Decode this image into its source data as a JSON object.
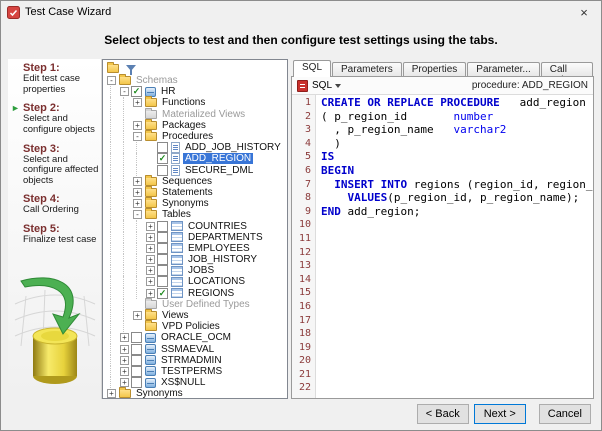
{
  "window": {
    "title": "Test Case Wizard",
    "close_glyph": "×"
  },
  "header": {
    "instruction": "Select objects to test and then configure test settings using the tabs."
  },
  "steps": [
    {
      "title": "Step 1:",
      "desc": "Edit test case properties",
      "current": false
    },
    {
      "title": "Step 2:",
      "desc": "Select and configure objects",
      "current": true
    },
    {
      "title": "Step 3:",
      "desc": "Select and configure affected objects",
      "current": false
    },
    {
      "title": "Step 4:",
      "desc": "Call Ordering",
      "current": false
    },
    {
      "title": "Step 5:",
      "desc": "Finalize test case",
      "current": false
    }
  ],
  "tree": {
    "rows": [
      {
        "label": "Schemas",
        "indent": 0,
        "exp": "minus",
        "icon": "folder",
        "gray": true
      },
      {
        "label": "HR",
        "indent": 1,
        "exp": "minus",
        "check": "on",
        "icon": "db"
      },
      {
        "label": "Functions",
        "indent": 2,
        "exp": "plus",
        "icon": "folder"
      },
      {
        "label": "Materialized Views",
        "indent": 2,
        "icon": "folder-gray",
        "gray": true
      },
      {
        "label": "Packages",
        "indent": 2,
        "exp": "plus",
        "icon": "folder"
      },
      {
        "label": "Procedures",
        "indent": 2,
        "exp": "minus",
        "icon": "folder"
      },
      {
        "label": "ADD_JOB_HISTORY",
        "indent": 3,
        "check": "off",
        "icon": "proc"
      },
      {
        "label": "ADD_REGION",
        "indent": 3,
        "check": "on",
        "icon": "proc",
        "selected": true
      },
      {
        "label": "SECURE_DML",
        "indent": 3,
        "check": "off",
        "icon": "proc"
      },
      {
        "label": "Sequences",
        "indent": 2,
        "exp": "plus",
        "icon": "folder"
      },
      {
        "label": "Statements",
        "indent": 2,
        "exp": "plus",
        "icon": "folder"
      },
      {
        "label": "Synonyms",
        "indent": 2,
        "exp": "plus",
        "icon": "folder"
      },
      {
        "label": "Tables",
        "indent": 2,
        "exp": "minus",
        "icon": "folder"
      },
      {
        "label": "COUNTRIES",
        "indent": 3,
        "exp": "plus",
        "check": "off",
        "icon": "table"
      },
      {
        "label": "DEPARTMENTS",
        "indent": 3,
        "exp": "plus",
        "check": "off",
        "icon": "table"
      },
      {
        "label": "EMPLOYEES",
        "indent": 3,
        "exp": "plus",
        "check": "off",
        "icon": "table"
      },
      {
        "label": "JOB_HISTORY",
        "indent": 3,
        "exp": "plus",
        "check": "off",
        "icon": "table"
      },
      {
        "label": "JOBS",
        "indent": 3,
        "exp": "plus",
        "check": "off",
        "icon": "table"
      },
      {
        "label": "LOCATIONS",
        "indent": 3,
        "exp": "plus",
        "check": "off",
        "icon": "table"
      },
      {
        "label": "REGIONS",
        "indent": 3,
        "exp": "plus",
        "check": "on",
        "icon": "table"
      },
      {
        "label": "User Defined Types",
        "indent": 2,
        "icon": "folder-gray",
        "gray": true
      },
      {
        "label": "Views",
        "indent": 2,
        "exp": "plus",
        "icon": "folder"
      },
      {
        "label": "VPD Policies",
        "indent": 2,
        "icon": "folder"
      },
      {
        "label": "ORACLE_OCM",
        "indent": 1,
        "exp": "plus",
        "check": "off",
        "icon": "db"
      },
      {
        "label": "SSMAEVAL",
        "indent": 1,
        "exp": "plus",
        "check": "off",
        "icon": "db"
      },
      {
        "label": "STRMADMIN",
        "indent": 1,
        "exp": "plus",
        "check": "off",
        "icon": "db"
      },
      {
        "label": "TESTPERMS",
        "indent": 1,
        "exp": "plus",
        "check": "off",
        "icon": "db"
      },
      {
        "label": "XS$NULL",
        "indent": 1,
        "exp": "plus",
        "check": "off",
        "icon": "db"
      },
      {
        "label": "Synonyms",
        "indent": 0,
        "exp": "plus",
        "icon": "folder"
      }
    ]
  },
  "editor": {
    "tabs": [
      {
        "label": "SQL",
        "active": true
      },
      {
        "label": "Parameters",
        "active": false
      },
      {
        "label": "Properties",
        "active": false
      },
      {
        "label": "Parameter...",
        "active": false
      },
      {
        "label": "Call Values",
        "active": false
      }
    ],
    "toolbar": {
      "dropdown_label": "SQL",
      "object_label": "procedure: ADD_REGION"
    },
    "total_lines": 22,
    "code": [
      [
        [
          "kw",
          "CREATE OR REPLACE PROCEDURE"
        ],
        [
          "pl",
          "   add_region"
        ]
      ],
      [
        [
          "pl",
          "( p_region_id       "
        ],
        [
          "ty",
          "number"
        ]
      ],
      [
        [
          "pl",
          "  , p_region_name   "
        ],
        [
          "ty",
          "varchar2"
        ]
      ],
      [
        [
          "pl",
          "  )"
        ]
      ],
      [
        [
          "kw",
          "IS"
        ]
      ],
      [
        [
          "kw",
          "BEGIN"
        ]
      ],
      [
        [
          "pl",
          "  "
        ],
        [
          "kw",
          "INSERT INTO"
        ],
        [
          "pl",
          " regions (region_id, region_name)"
        ]
      ],
      [
        [
          "pl",
          "    "
        ],
        [
          "kw",
          "VALUES"
        ],
        [
          "pl",
          "(p_region_id, p_region_name);"
        ]
      ],
      [
        [
          "kw",
          "END"
        ],
        [
          "pl",
          " add_region;"
        ]
      ]
    ]
  },
  "footer": {
    "back": "< Back",
    "next": "Next >",
    "cancel": "Cancel"
  },
  "colors": {
    "keyword": "#0000cc",
    "datatype": "#0000ee",
    "line_number": "#8b3b3b",
    "selection": "#3875d7",
    "step_title": "#7b2f2f",
    "arrow": "#2e9e3e"
  }
}
